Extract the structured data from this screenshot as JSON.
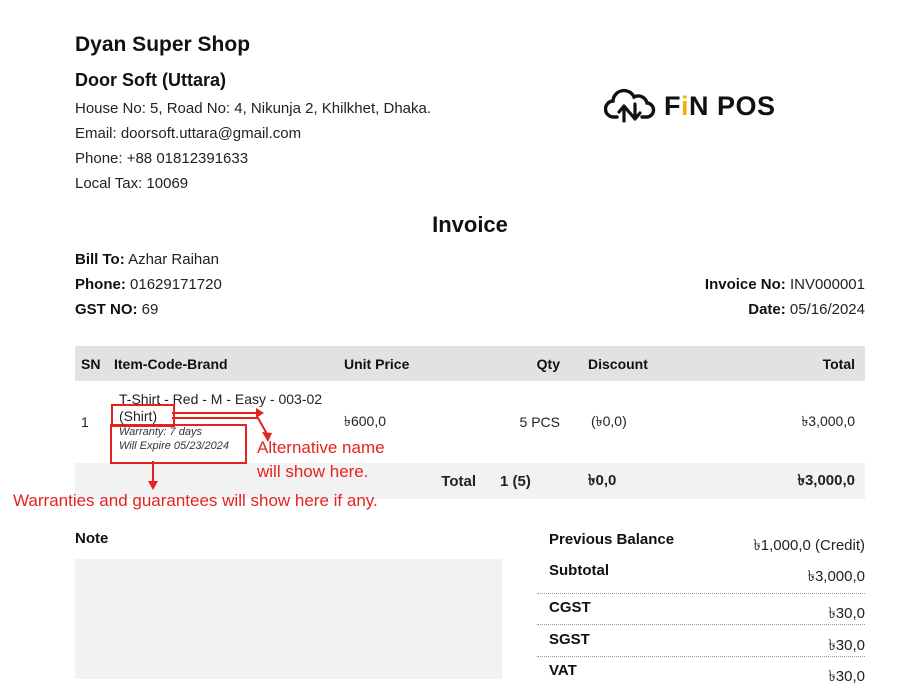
{
  "shop": {
    "name": "Dyan Super Shop",
    "branch": "Door Soft (Uttara)",
    "address": "House No: 5, Road No: 4, Nikunja 2, Khilkhet, Dhaka.",
    "email": "Email: doorsoft.uttara@gmail.com",
    "phone": "Phone: +88 01812391633",
    "tax": "Local Tax: 10069"
  },
  "logo": {
    "text_f": "F",
    "text_i": "i",
    "text_rest": "N POS",
    "icon": "cloud-upload-download-icon"
  },
  "invoice": {
    "title": "Invoice",
    "bill_to_label": "Bill To:",
    "bill_to": "Azhar Raihan",
    "phone_label": "Phone:",
    "phone": "01629171720",
    "gst_label": "GST NO:",
    "gst": "69",
    "no_label": "Invoice No:",
    "no": "INV000001",
    "date_label": "Date:",
    "date": "05/16/2024"
  },
  "table": {
    "headers": {
      "sn": "SN",
      "item": "Item-Code-Brand",
      "unit_price": "Unit Price",
      "qty": "Qty",
      "discount": "Discount",
      "total": "Total"
    },
    "rows": [
      {
        "sn": "1",
        "item": "T-Shirt - Red - M - Easy - 003-02",
        "alt_name": "(Shirt)",
        "warranty": "Warranty: 7 days",
        "expire": "Will Expire 05/23/2024",
        "unit_price": "৳600,0",
        "qty": "5 PCS",
        "discount": "(৳0,0)",
        "total": "৳3,000,0"
      }
    ],
    "total_row": {
      "label": "Total",
      "qty": "1 (5)",
      "discount": "৳0,0",
      "total": "৳3,000,0"
    }
  },
  "note": {
    "label": "Note"
  },
  "summary": {
    "previous_label": "Previous Balance",
    "previous": "৳1,000,0 (Credit)",
    "subtotal_label": "Subtotal",
    "subtotal": "৳3,000,0",
    "cgst_label": "CGST",
    "cgst": "৳30,0",
    "sgst_label": "SGST",
    "sgst": "৳30,0",
    "vat_label": "VAT",
    "vat": "৳30,0"
  },
  "annotations": {
    "alt_line1": "Alternative name",
    "alt_line2": "will show here.",
    "warranty_note": "Warranties and guarantees will show here if any.",
    "color": "#e52222"
  }
}
